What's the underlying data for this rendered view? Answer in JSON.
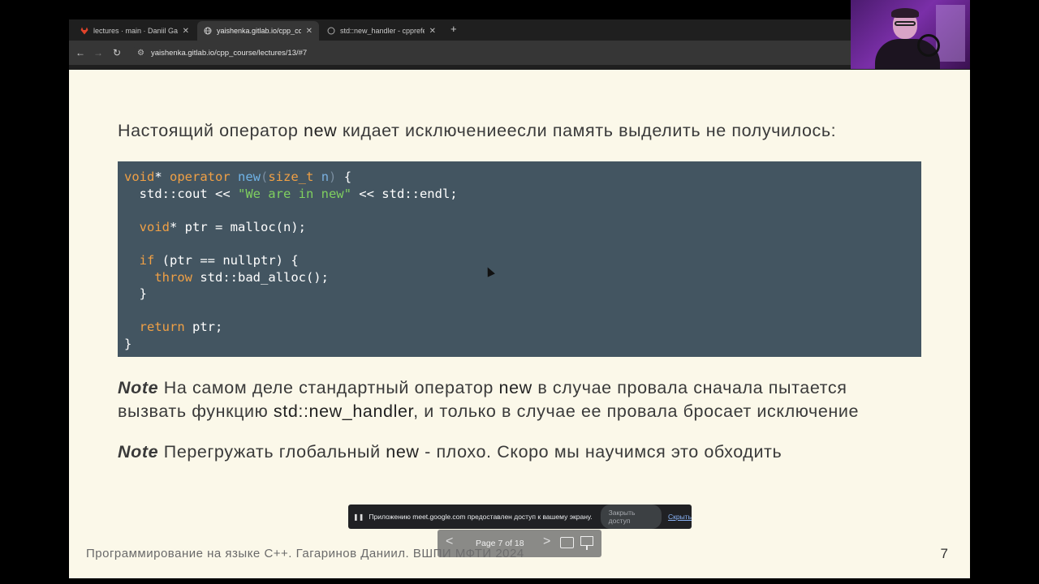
{
  "browser": {
    "tabs": [
      {
        "title": "lectures · main · Daniil Gagari",
        "favicon": "gitlab-icon",
        "active": false
      },
      {
        "title": "yaishenka.gitlab.io/cpp_cours",
        "favicon": "globe-icon",
        "active": true
      },
      {
        "title": "std::new_handler - cpprefere",
        "favicon": "cppreference-icon",
        "active": false
      }
    ],
    "new_tab": "+",
    "url": "yaishenka.gitlab.io/cpp_course/lectures/13/#7"
  },
  "slide": {
    "intro_prefix": "Настоящий оператор ",
    "intro_kw": "new",
    "intro_suffix": " кидает исключениеесли память выделить не получилось:",
    "code": {
      "l1_kw": "void",
      "l1_a": "* ",
      "l1_kw2": "operator",
      "l1_sp": " ",
      "l1_fn": "new",
      "l1_p1": "(",
      "l1_type": "size_t",
      "l1_sp2": " ",
      "l1_arg": "n",
      "l1_p2": ")",
      "l1_end": " {",
      "l2_a": "  std::cout << ",
      "l2_str": "\"We are in new\"",
      "l2_b": " << std::endl;",
      "l4_ind": "  ",
      "l4_kw": "void",
      "l4_b": "* ptr = malloc(n);",
      "l6_ind": "  ",
      "l6_kw": "if",
      "l6_b": " (ptr == nullptr) {",
      "l7_ind": "    ",
      "l7_kw": "throw",
      "l7_b": " std::bad_alloc();",
      "l8": "  }",
      "l10_ind": "  ",
      "l10_kw": "return",
      "l10_b": " ptr;",
      "l11": "}"
    },
    "note1": {
      "label": "Note",
      "line1_a": " На самом деле стандартный оператор ",
      "line1_kw": "new",
      "line1_b": " в случае провала сначала пытается",
      "line2_a": "вызвать функцию ",
      "line2_kw": "std::new_handler",
      "line2_b": ", и только в случае ее провала бросает исключение"
    },
    "note2": {
      "label": "Note",
      "text_a": " Перегружать глобальный ",
      "text_kw": "new",
      "text_b": " - плохо. Скоро мы научимся это обходить"
    },
    "footer": "Программирование на языке С++. Гагаринов Даниил. ВШПИ МФТИ 2024",
    "page_number": "7"
  },
  "share_bar": {
    "message": "Приложению meet.google.com предоставлен доступ к вашему экрану.",
    "stop_label": "Закрыть доступ",
    "hide_label": "Скрыть"
  },
  "pdf_nav": {
    "label": "Page 7 of 18"
  }
}
